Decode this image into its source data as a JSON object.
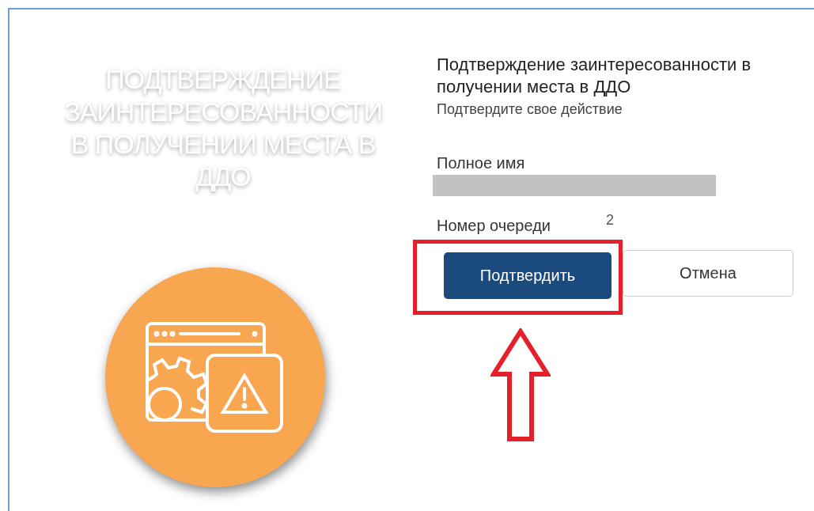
{
  "hero": {
    "title": "ПОДТВЕРЖДЕНИЕ ЗАИНТЕРЕСОВАННОСТИ В ПОЛУЧЕНИИ МЕСТА В ДДО"
  },
  "dialog": {
    "title": "Подтверждение заинтересованности в получении места в ДДО",
    "subtitle": "Подтвердите свое действие",
    "fields": [
      {
        "label": "Полное имя",
        "redacted": true
      },
      {
        "label": "Номер очереди",
        "value": "2",
        "redacted": false
      }
    ],
    "buttons": [
      {
        "label": "Подтвердить",
        "kind": "primary",
        "highlighted": true
      },
      {
        "label": "Отмена",
        "kind": "secondary",
        "highlighted": false
      }
    ]
  }
}
